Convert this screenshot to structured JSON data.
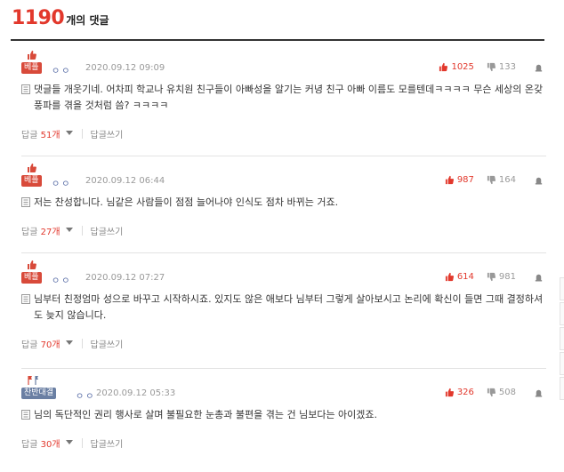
{
  "header": {
    "count": "1190",
    "label": "개의 댓글"
  },
  "actions": {
    "reply_label": "답글",
    "write_label": "답글쓰기"
  },
  "comments": [
    {
      "badge": "베플",
      "badge_color": "#d84a3a",
      "nick": "ㅇㅇ",
      "date": "2020.09.12 09:09",
      "up": "1025",
      "down": "133",
      "text": "댓글들 개웃기네. 어차피 학교나 유치원 친구들이 아빠성을 알기는 커녕 친구 아빠 이름도 모를텐데ㅋㅋㅋㅋ 무슨 세상의 온갖 풍파를 겪을 것처럼 씀? ㅋㅋㅋㅋ",
      "replies": "51개"
    },
    {
      "badge": "베플",
      "badge_color": "#d84a3a",
      "nick": "ㅇㅇ",
      "date": "2020.09.12 06:44",
      "up": "987",
      "down": "164",
      "text": "저는 찬성합니다. 님같은 사람들이 점점 늘어나야 인식도 점차 바뀌는 거죠.",
      "replies": "27개"
    },
    {
      "badge": "베플",
      "badge_color": "#d84a3a",
      "nick": "ㅇㅇ",
      "date": "2020.09.12 07:27",
      "up": "614",
      "down": "981",
      "text": "님부터 친정엄마 성으로 바꾸고 시작하시죠. 있지도 않은 애보다 님부터 그렇게 살아보시고 논리에 확신이 들면 그때 결정하셔도 늦지 않습니다.",
      "replies": "70개"
    },
    {
      "badge": "찬반대결",
      "badge_color": "#6a7fa3",
      "nick": "ㅇㅇ",
      "date": "2020.09.12 05:33",
      "up": "326",
      "down": "508",
      "text": "님의 독단적인 권리 행사로 살며 불필요한 눈총과 불편을 겪는 건 님보다는 아이겠죠.",
      "replies": "30개"
    }
  ]
}
